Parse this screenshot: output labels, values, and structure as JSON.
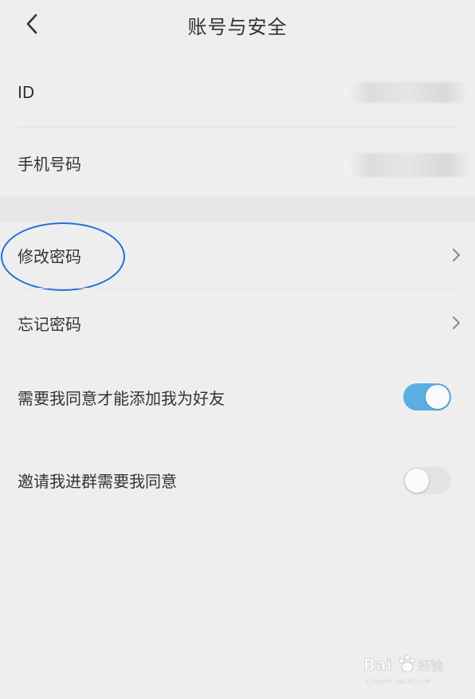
{
  "header": {
    "title": "账号与安全"
  },
  "rows": {
    "id_label": "ID",
    "phone_label": "手机号码",
    "change_password": "修改密码",
    "forgot_password": "忘记密码",
    "require_friend_consent": "需要我同意才能添加我为好友",
    "require_group_consent": "邀请我进群需要我同意"
  },
  "toggles": {
    "require_friend_consent_on": true,
    "require_group_consent_on": false
  },
  "colors": {
    "toggle_on": "#5aaee3",
    "highlight_circle": "#1f6fd6"
  }
}
